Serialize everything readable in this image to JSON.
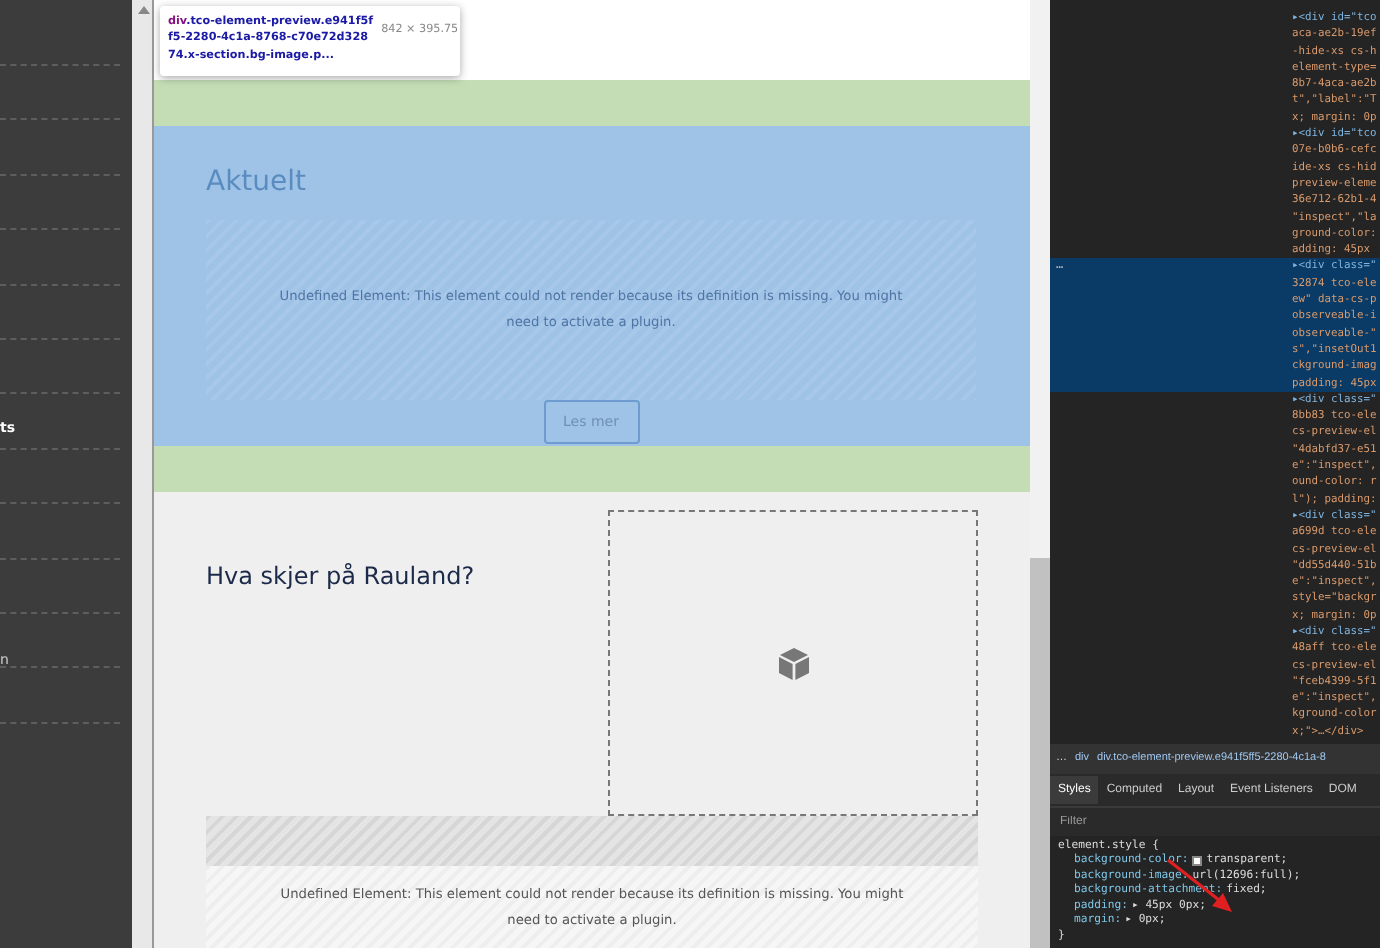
{
  "sidebar": {
    "items": [
      {
        "label": "ts"
      },
      {
        "label": "n"
      }
    ]
  },
  "tooltip": {
    "tag": "div",
    "selector_lines": [
      ".tco-element-preview.e941f5f",
      "f5-2280-4c1a-8768-c70e72d328",
      "74.x-section.bg-image.p..."
    ],
    "size": "842 × 395.75"
  },
  "preview": {
    "aktuelt": {
      "heading": "Aktuelt",
      "message": "Undefined Element: This element could not render because its definition is missing. You might need to activate a plugin.",
      "button": "Les mer"
    },
    "rauland": {
      "heading": "Hva skjer på Rauland?",
      "message": "Undefined Element: This element could not render because its definition is missing. You might need to activate a plugin."
    }
  },
  "dom_nodes": [
    {
      "selected": false,
      "lines": [
        "▸<div id=\"tco",
        "aca-ae2b-19ef",
        "-hide-xs cs-h",
        "element-type=",
        "8b7-4aca-ae2b",
        "t\",\"label\":\"T",
        "x; margin: 0p"
      ]
    },
    {
      "selected": false,
      "lines": [
        "▸<div id=\"tco",
        "07e-b0b6-cefc",
        "ide-xs cs-hid",
        "preview-eleme",
        "36e712-62b1-4",
        "\"inspect\",\"la",
        "ground-color:",
        "adding: 45px"
      ]
    },
    {
      "selected": true,
      "lines": [
        "▸<div class=\"",
        "32874 tco-ele",
        "ew\" data-cs-p",
        "observeable-i",
        "observeable-\"",
        "s\",\"insetOut1",
        "ckground-imag",
        "padding: 45px"
      ]
    },
    {
      "selected": false,
      "lines": [
        "▸<div class=\"",
        "8bb83 tco-ele",
        "cs-preview-el",
        "\"4dabfd37-e51",
        "e\":\"inspect\",",
        "ound-color: r",
        "l\"); padding:"
      ]
    },
    {
      "selected": false,
      "lines": [
        "▸<div class=\"",
        "a699d tco-ele",
        "cs-preview-el",
        "\"dd55d440-51b",
        "e\":\"inspect\",",
        "style=\"backgr",
        "x; margin: 0p"
      ]
    },
    {
      "selected": false,
      "lines": [
        "▸<div class=\"",
        "48aff tco-ele",
        "cs-preview-el",
        "\"fceb4399-5f1",
        "e\":\"inspect\",",
        "kground-color",
        "x;\">…</div>"
      ]
    }
  ],
  "selected_marker": "…",
  "breadcrumb": [
    "…",
    "div",
    "div.tco-element-preview.e941f5ff5-2280-4c1a-8"
  ],
  "tabs": [
    {
      "label": "Styles",
      "selected": true
    },
    {
      "label": "Computed",
      "selected": false
    },
    {
      "label": "Layout",
      "selected": false
    },
    {
      "label": "Event Listeners",
      "selected": false
    },
    {
      "label": "DOM",
      "selected": false
    }
  ],
  "filter": {
    "placeholder": "Filter"
  },
  "styles": {
    "selector": "element.style {",
    "close": "}",
    "declarations": [
      {
        "property": "background-color:",
        "value": "transparent;",
        "kind": "color"
      },
      {
        "property": "background-image:",
        "value": "url(12696:full);"
      },
      {
        "property": "background-attachment:",
        "value": "fixed;"
      },
      {
        "property": "padding:",
        "value": "▸ 45px 0px;"
      },
      {
        "property": "margin:",
        "value": "▸ 0px;"
      }
    ]
  }
}
